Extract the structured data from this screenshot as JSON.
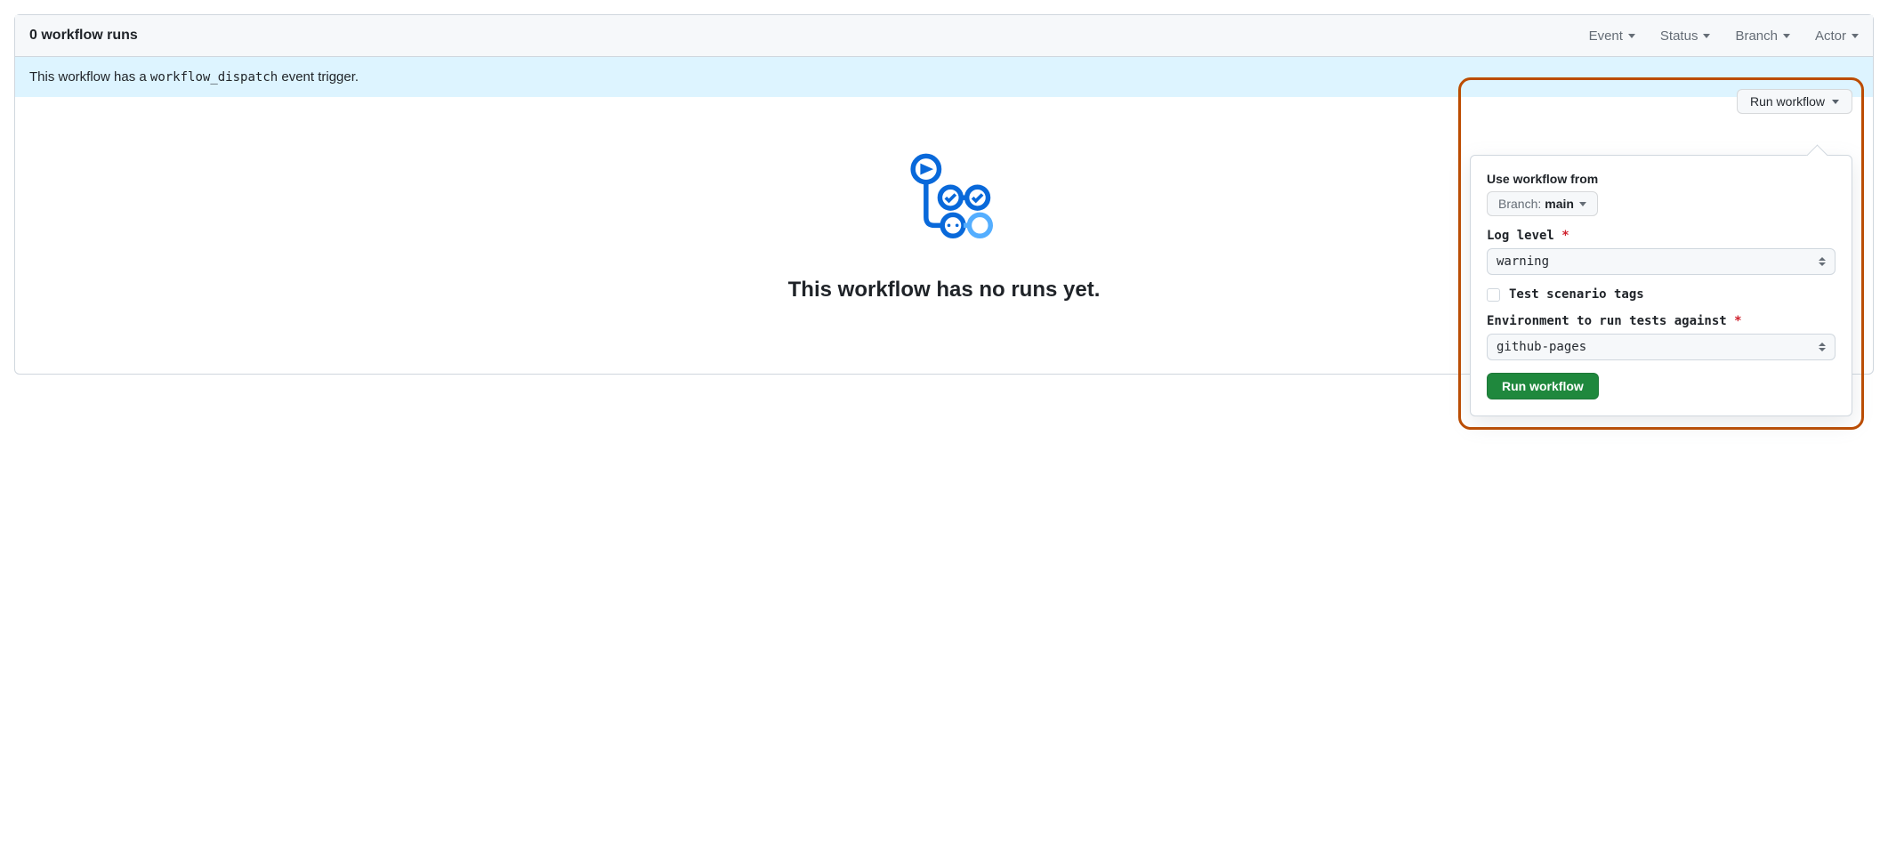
{
  "header": {
    "run_count_label": "0 workflow runs",
    "filters": {
      "event": "Event",
      "status": "Status",
      "branch": "Branch",
      "actor": "Actor"
    }
  },
  "dispatch": {
    "prefix": "This workflow has a ",
    "code": "workflow_dispatch",
    "suffix": " event trigger.",
    "run_button": "Run workflow"
  },
  "empty": {
    "title": "This workflow has no runs yet."
  },
  "popover": {
    "use_from_label": "Use workflow from",
    "branch_prefix": "Branch:",
    "branch_value": "main",
    "log_level": {
      "label": "Log level",
      "required_mark": "*",
      "value": "warning"
    },
    "scenario": {
      "label": "Test scenario tags",
      "checked": false
    },
    "environment": {
      "label": "Environment to run tests against",
      "required_mark": "*",
      "value": "github-pages"
    },
    "submit": "Run workflow"
  }
}
